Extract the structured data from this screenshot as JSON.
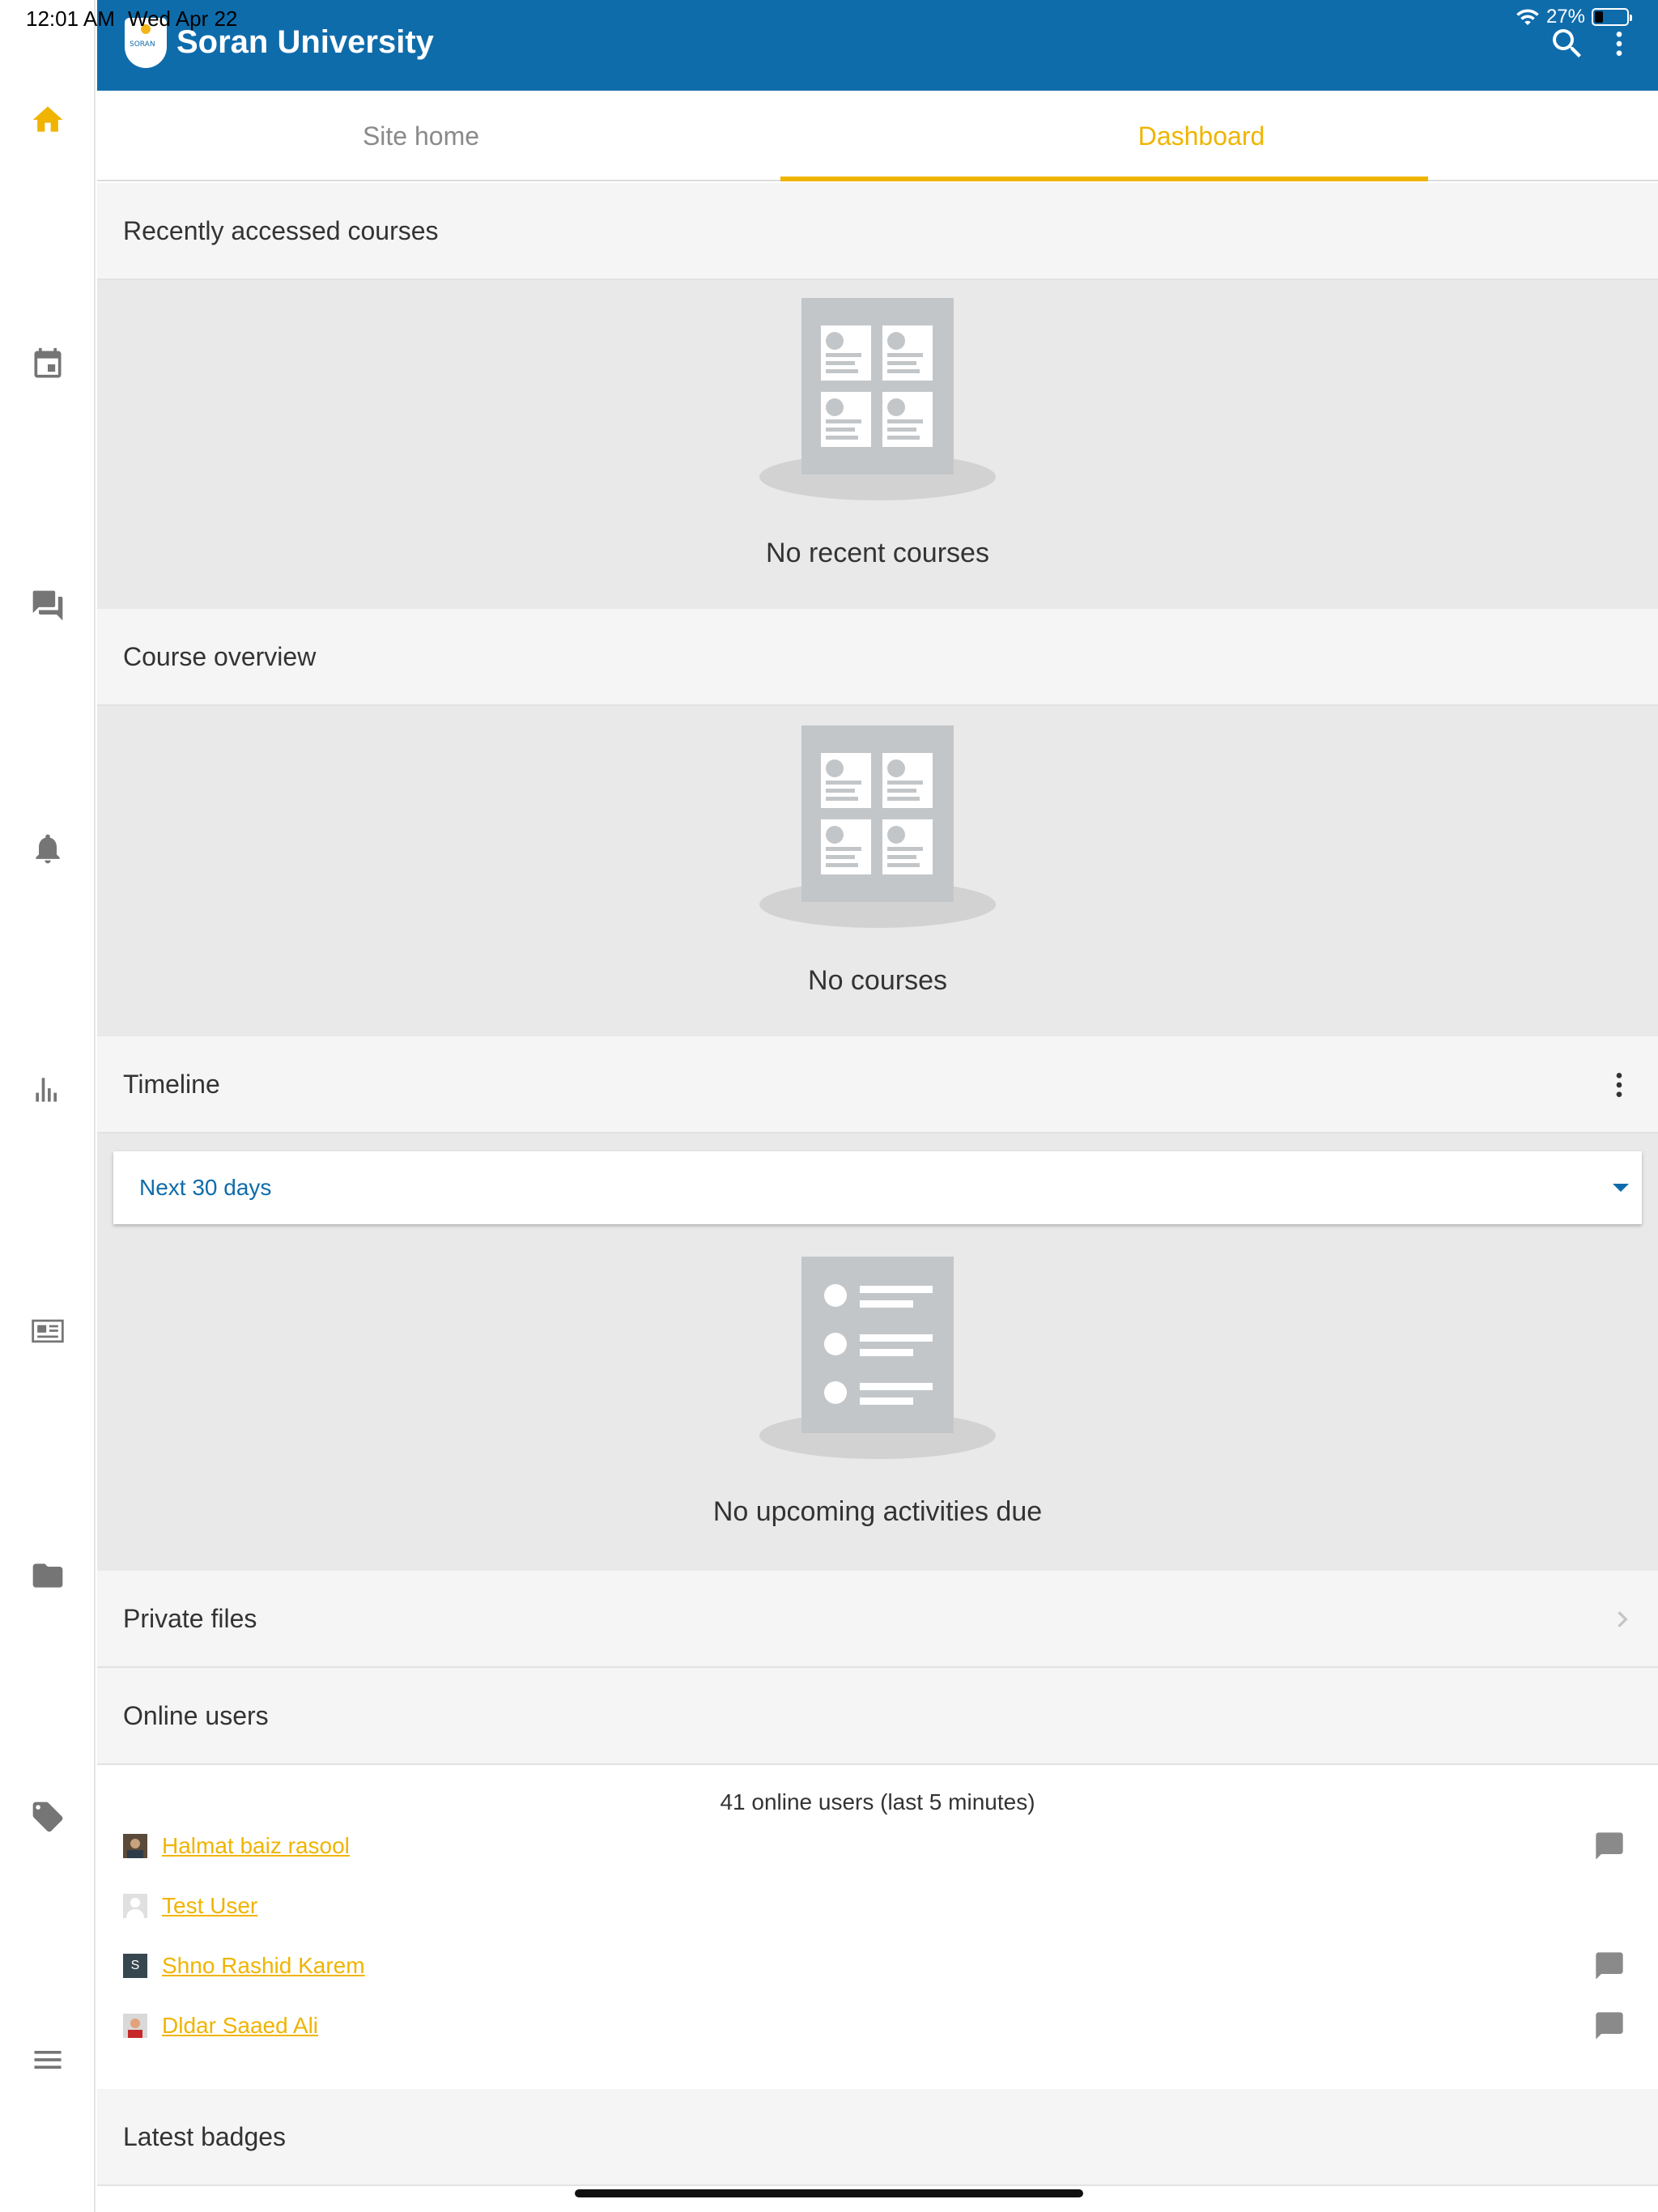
{
  "status_bar": {
    "time": "12:01 AM",
    "date": "Wed Apr 22",
    "battery": "27%",
    "battery_level": 0.27
  },
  "app": {
    "title": "Soran University",
    "logo_text": "SORAN"
  },
  "tabs": [
    {
      "label": "Site home",
      "active": false
    },
    {
      "label": "Dashboard",
      "active": true
    }
  ],
  "sidenav": {
    "items": [
      {
        "name": "home-icon",
        "active": true
      },
      {
        "name": "calendar-icon",
        "active": false
      },
      {
        "name": "messages-icon",
        "active": false
      },
      {
        "name": "notifications-icon",
        "active": false
      },
      {
        "name": "grades-icon",
        "active": false
      },
      {
        "name": "news-icon",
        "active": false
      },
      {
        "name": "folder-icon",
        "active": false
      },
      {
        "name": "tag-icon",
        "active": false
      },
      {
        "name": "menu-icon",
        "active": false
      }
    ]
  },
  "blocks": {
    "recent": {
      "title": "Recently accessed courses",
      "empty": "No recent courses"
    },
    "overview": {
      "title": "Course overview",
      "empty": "No courses"
    },
    "timeline": {
      "title": "Timeline",
      "filter": "Next 30 days",
      "empty": "No upcoming activities due"
    },
    "private_files": {
      "title": "Private files"
    },
    "online_users": {
      "title": "Online users",
      "count_text": "41 online users (last 5 minutes)",
      "users": [
        {
          "name": "Halmat baiz rasool",
          "avatar": "photo",
          "message": true
        },
        {
          "name": "Test User",
          "avatar": "default",
          "message": false
        },
        {
          "name": "Shno Rashid Karem",
          "avatar": "initial",
          "initial": "S",
          "message": true
        },
        {
          "name": "Dldar Saaed Ali",
          "avatar": "photo",
          "message": true
        }
      ]
    },
    "latest_badges": {
      "title": "Latest badges"
    }
  },
  "colors": {
    "brand": "#0f6cab",
    "accent": "#f0b400",
    "icon_gray": "#757575"
  }
}
